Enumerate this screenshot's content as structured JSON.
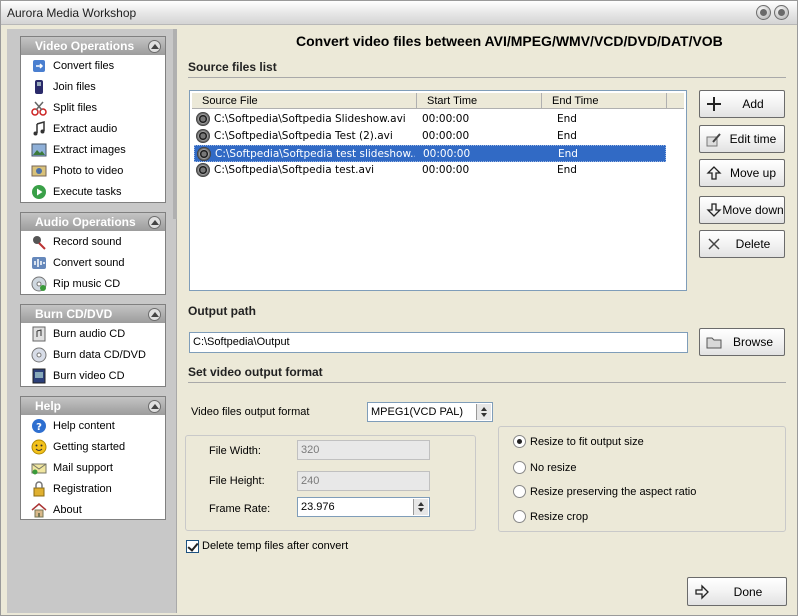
{
  "window": {
    "title": "Aurora Media Workshop"
  },
  "sidebar": {
    "groups": [
      {
        "title": "Video Operations",
        "items": [
          {
            "label": "Convert files",
            "icon": "convert-icon"
          },
          {
            "label": "Join files",
            "icon": "join-icon"
          },
          {
            "label": "Split files",
            "icon": "scissors-icon"
          },
          {
            "label": "Extract audio",
            "icon": "music-note-icon"
          },
          {
            "label": "Extract images",
            "icon": "image-icon"
          },
          {
            "label": "Photo to video",
            "icon": "photo-video-icon"
          },
          {
            "label": "Execute tasks",
            "icon": "play-icon"
          }
        ]
      },
      {
        "title": "Audio Operations",
        "items": [
          {
            "label": "Record sound",
            "icon": "microphone-icon"
          },
          {
            "label": "Convert sound",
            "icon": "sound-convert-icon"
          },
          {
            "label": "Rip music CD",
            "icon": "cd-rip-icon"
          }
        ]
      },
      {
        "title": "Burn CD/DVD",
        "items": [
          {
            "label": "Burn audio CD",
            "icon": "audio-cd-icon"
          },
          {
            "label": "Burn data CD/DVD",
            "icon": "data-cd-icon"
          },
          {
            "label": "Burn video CD",
            "icon": "video-cd-icon"
          }
        ]
      },
      {
        "title": "Help",
        "items": [
          {
            "label": "Help content",
            "icon": "help-icon"
          },
          {
            "label": "Getting started",
            "icon": "smiley-icon"
          },
          {
            "label": "Mail support",
            "icon": "mail-icon"
          },
          {
            "label": "Registration",
            "icon": "lock-icon"
          },
          {
            "label": "About",
            "icon": "home-icon"
          }
        ]
      }
    ]
  },
  "main": {
    "title": "Convert video files between AVI/MPEG/WMV/VCD/DVD/DAT/VOB",
    "source_section": "Source files list",
    "columns": [
      "Source File",
      "Start Time",
      "End Time"
    ],
    "rows": [
      {
        "file": "C:\\Softpedia\\Softpedia Slideshow.avi",
        "start": "00:00:00",
        "end": "End",
        "selected": false
      },
      {
        "file": "C:\\Softpedia\\Softpedia Test (2).avi",
        "start": "00:00:00",
        "end": "End",
        "selected": false
      },
      {
        "file": "C:\\Softpedia\\Softpedia test slideshow....",
        "start": "00:00:00",
        "end": "End",
        "selected": true
      },
      {
        "file": "C:\\Softpedia\\Softpedia test.avi",
        "start": "00:00:00",
        "end": "End",
        "selected": false
      }
    ],
    "buttons": {
      "add": "Add",
      "edit_time": "Edit time",
      "move_up": "Move up",
      "move_down": "Move down",
      "delete": "Delete",
      "browse": "Browse",
      "done": "Done"
    },
    "output_section": "Output path",
    "output_path": "C:\\Softpedia\\Output",
    "format_section": "Set video output format",
    "format_label": "Video files output format",
    "format_value": "MPEG1(VCD PAL)",
    "file_width_label": "File Width:",
    "file_width": "320",
    "file_height_label": "File Height:",
    "file_height": "240",
    "frame_rate_label": "Frame Rate:",
    "frame_rate": "23.976",
    "resize_options": [
      {
        "label": "Resize to fit output size",
        "checked": true
      },
      {
        "label": "No resize",
        "checked": false
      },
      {
        "label": "Resize preserving the aspect ratio",
        "checked": false
      },
      {
        "label": "Resize crop",
        "checked": false
      }
    ],
    "delete_temp_label": "Delete temp files after convert",
    "delete_temp_checked": true
  }
}
